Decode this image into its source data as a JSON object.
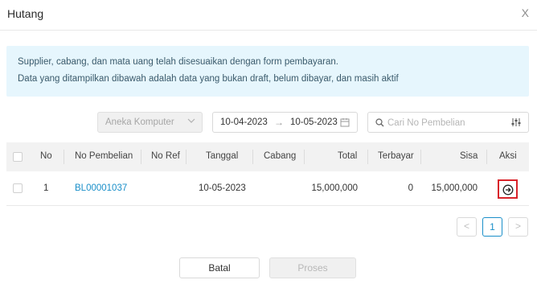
{
  "dialog": {
    "title": "Hutang",
    "close_glyph": "X"
  },
  "alert": {
    "line1": "Supplier, cabang, dan mata uang telah disesuaikan dengan form pembayaran.",
    "line2": "Data yang ditampilkan dibawah adalah data yang bukan draft, belum dibayar, dan masih aktif"
  },
  "filters": {
    "supplier": {
      "value": "Aneka Komputer",
      "icon": "chevron-down-icon"
    },
    "date_from": "10-04-2023",
    "date_arrow": "→",
    "date_to": "10-05-2023",
    "search_placeholder": "Cari No Pembelian"
  },
  "table": {
    "columns": [
      "No",
      "No Pembelian",
      "No Ref",
      "Tanggal",
      "Cabang",
      "Total",
      "Terbayar",
      "Sisa",
      "Aksi"
    ],
    "rows": [
      {
        "no": "1",
        "no_pembelian": "BL00001037",
        "no_ref": "",
        "tanggal": "10-05-2023",
        "cabang": "",
        "total": "15,000,000",
        "terbayar": "0",
        "sisa": "15,000,000",
        "action_icon": "arrow-circle-right-icon"
      }
    ]
  },
  "pagination": {
    "prev": "<",
    "current": "1",
    "next": ">"
  },
  "footer": {
    "cancel_label": "Batal",
    "process_label": "Proses"
  },
  "colors": {
    "accent": "#1a8fc9",
    "alert_bg": "#e6f6fd",
    "highlight": "#d9232a"
  }
}
